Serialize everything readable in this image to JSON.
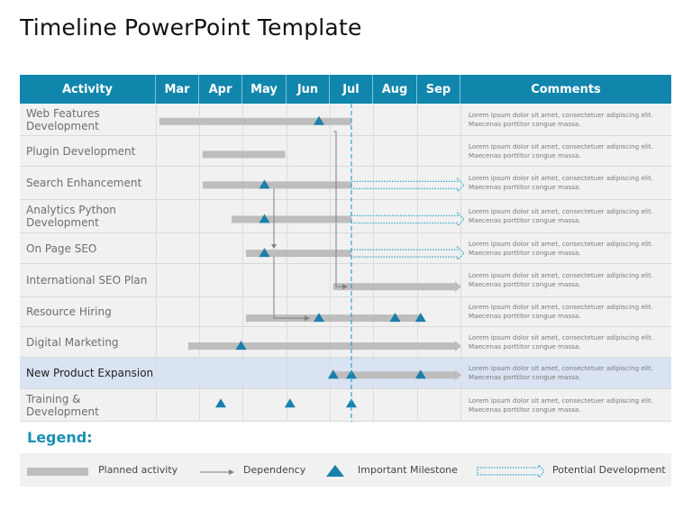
{
  "title": "Timeline PowerPoint Template",
  "colors": {
    "header": "#1186ad",
    "milestone": "#1a7fab",
    "bar": "#bdbdbd",
    "dependency": "#7f7f7f",
    "potential": "#2aa6cc",
    "today_line": "#2aa6cc",
    "highlight_row": "#d9e3f2"
  },
  "table": {
    "headers": {
      "activity": "Activity",
      "months": [
        "Mar",
        "Apr",
        "May",
        "Jun",
        "Jul",
        "Aug",
        "Sep"
      ],
      "comments": "Comments"
    },
    "current_marker_month": "Jul (mid)",
    "rows": [
      {
        "activity": "Web Features Development",
        "comment": "Lorem ipsum dolor sit amet, consectetuer adipiscing elit. Maecenas porttitor congue massa.",
        "bar": {
          "start": "Mar (start)",
          "end": "Jul (mid)"
        },
        "milestones": [
          "Jun (late)"
        ],
        "potential": false,
        "highlight": false
      },
      {
        "activity": "Plugin  Development",
        "comment": "Lorem ipsum dolor sit amet, consectetuer adipiscing elit. Maecenas porttitor congue massa.",
        "bar": {
          "start": "Apr (start)",
          "end": "May (end)"
        },
        "milestones": [],
        "potential": false,
        "highlight": false
      },
      {
        "activity": "Search Enhancement",
        "comment": "Lorem ipsum dolor sit amet, consectetuer adipiscing elit. Maecenas porttitor congue massa.",
        "bar": {
          "start": "Apr (start)",
          "end": "Jul (mid)"
        },
        "milestones": [
          "May (mid)"
        ],
        "potential": true,
        "highlight": false
      },
      {
        "activity": "Analytics Python Development",
        "comment": "Lorem ipsum dolor sit amet, consectetuer adipiscing elit. Maecenas porttitor congue massa.",
        "bar": {
          "start": "Apr (late)",
          "end": "Jul (mid)"
        },
        "milestones": [
          "May (mid)"
        ],
        "potential": true,
        "highlight": false
      },
      {
        "activity": "On Page SEO",
        "comment": "Lorem ipsum dolor sit amet, consectetuer adipiscing elit. Maecenas porttitor congue massa.",
        "bar": {
          "start": "May (start)",
          "end": "Jul (mid)"
        },
        "milestones": [
          "May (mid)"
        ],
        "potential": true,
        "highlight": false
      },
      {
        "activity": "International  SEO Plan",
        "comment": "Lorem ipsum dolor sit amet, consectetuer adipiscing elit. Maecenas porttitor congue massa.",
        "bar": {
          "start": "Jul (start)",
          "end": "Sep (end)"
        },
        "milestones": [],
        "potential": false,
        "highlight": false
      },
      {
        "activity": "Resource Hiring",
        "comment": "Lorem ipsum dolor sit amet, consectetuer adipiscing elit. Maecenas porttitor congue massa.",
        "bar": {
          "start": "May (start)",
          "end": "Sep (start)"
        },
        "milestones": [
          "Jun (late)",
          "Aug (mid)",
          "Sep (start)"
        ],
        "potential": false,
        "highlight": false
      },
      {
        "activity": "Digital  Marketing",
        "comment": "Lorem ipsum dolor sit amet, consectetuer adipiscing elit. Maecenas porttitor congue massa.",
        "bar": {
          "start": "Mar (late)",
          "end": "Sep (end)"
        },
        "milestones": [
          "Apr (end)"
        ],
        "potential": false,
        "highlight": false
      },
      {
        "activity": "New Product Expansion",
        "comment": "Lorem ipsum dolor sit amet, consectetuer adipiscing elit. Maecenas porttitor congue massa.",
        "bar": {
          "start": "Jul (start)",
          "end": "Sep (end)"
        },
        "milestones": [
          "Jul (start)",
          "Jul (mid)",
          "Sep (start)"
        ],
        "potential": false,
        "highlight": true
      },
      {
        "activity": "Training  & Development",
        "comment": "Lorem ipsum dolor sit amet, consectetuer adipiscing elit. Maecenas porttitor congue massa.",
        "bar": null,
        "milestones": [
          "Apr (mid)",
          "Jun (start)",
          "Jul (mid)"
        ],
        "potential": false,
        "highlight": false
      }
    ],
    "dependencies": [
      {
        "from": "Web Features Development",
        "to": "International  SEO Plan"
      },
      {
        "from": "Search Enhancement",
        "to": "On Page SEO"
      },
      {
        "from": "On Page SEO",
        "to": "Resource Hiring"
      }
    ]
  },
  "legend": {
    "title": "Legend:",
    "items": [
      {
        "icon": "planned-bar-icon",
        "label": "Planned  activity"
      },
      {
        "icon": "dependency-arrow-icon",
        "label": "Dependency"
      },
      {
        "icon": "milestone-triangle-icon",
        "label": "Important  Milestone"
      },
      {
        "icon": "potential-arrow-icon",
        "label": "Potential Development"
      }
    ]
  }
}
